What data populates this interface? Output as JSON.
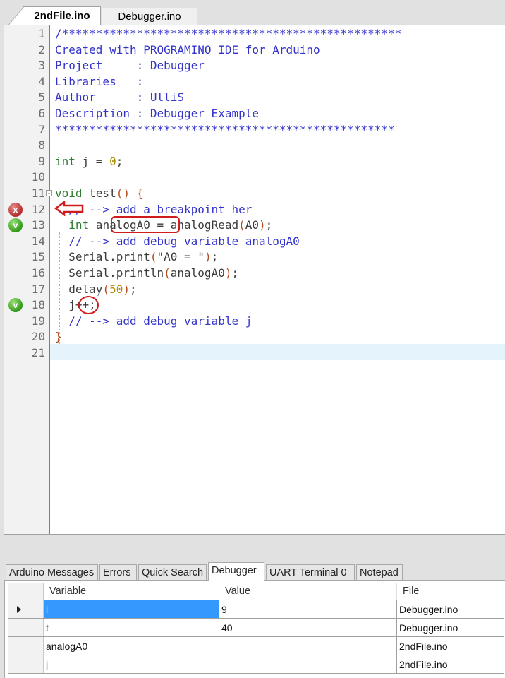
{
  "file_tabs": [
    {
      "label": "2ndFile.ino",
      "active": true
    },
    {
      "label": "Debugger.ino",
      "active": false
    }
  ],
  "editor": {
    "lines": [
      {
        "n": "1",
        "code": "/**************************************************"
      },
      {
        "n": "2",
        "code": "Created with PROGRAMINO IDE for Arduino"
      },
      {
        "n": "3",
        "code": "Project     : Debugger"
      },
      {
        "n": "4",
        "code": "Libraries   :"
      },
      {
        "n": "5",
        "code": "Author      : UlliS"
      },
      {
        "n": "6",
        "code": "Description : Debugger Example"
      },
      {
        "n": "7",
        "code": "**************************************************"
      },
      {
        "n": "8",
        "code": ""
      },
      {
        "n": "9",
        "code": "int j = 0;"
      },
      {
        "n": "10",
        "code": ""
      },
      {
        "n": "11",
        "code": "void test() {"
      },
      {
        "n": "12",
        "code": "  // --> add a breakpoint her"
      },
      {
        "n": "13",
        "code": "  int analogA0 = analogRead(A0);"
      },
      {
        "n": "14",
        "code": "  // --> add debug variable analogA0"
      },
      {
        "n": "15",
        "code": "  Serial.print(\"A0 = \");"
      },
      {
        "n": "16",
        "code": "  Serial.println(analogA0);"
      },
      {
        "n": "17",
        "code": "  delay(50);"
      },
      {
        "n": "18",
        "code": "  j++;"
      },
      {
        "n": "19",
        "code": "  // --> add debug variable j"
      },
      {
        "n": "20",
        "code": "}"
      },
      {
        "n": "21",
        "code": ""
      }
    ],
    "markers": {
      "breakpoint_line": "12",
      "breakpoint_glyph": "x",
      "watch_lines": [
        "13",
        "18"
      ],
      "watch_glyph": "v"
    },
    "current_line": "21"
  },
  "panel": {
    "tabs": [
      {
        "label": "Arduino Messages",
        "active": false
      },
      {
        "label": "Errors",
        "active": false
      },
      {
        "label": "Quick Search",
        "active": false
      },
      {
        "label": "Debugger",
        "active": true
      },
      {
        "label": "UART Terminal 0",
        "active": false
      },
      {
        "label": "Notepad",
        "active": false
      }
    ],
    "grid": {
      "columns": [
        "Variable",
        "Value",
        "File"
      ],
      "rows": [
        {
          "variable": "i",
          "value": "9",
          "file": "Debugger.ino",
          "selected": true
        },
        {
          "variable": "t",
          "value": "40",
          "file": "Debugger.ino",
          "selected": false
        },
        {
          "variable": "analogA0",
          "value": "",
          "file": "2ndFile.ino",
          "selected": false
        },
        {
          "variable": "j",
          "value": "",
          "file": "2ndFile.ino",
          "selected": false
        }
      ]
    }
  },
  "colors": {
    "comment": "#3333cc",
    "keyword": "#2e7d32",
    "number": "#b08a00",
    "annotation": "#d01c1c",
    "selection": "#3399ff",
    "gutter_line": "#3b8fd4"
  }
}
